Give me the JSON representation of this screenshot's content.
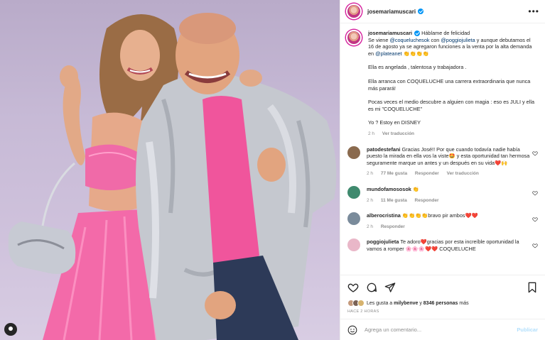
{
  "post": {
    "author": "josemariamuscari",
    "caption": {
      "title": "Háblame de felicidad",
      "p1_pre": "Se viene ",
      "p1_m1": "@coqueluchesok",
      "p1_mid": " con ",
      "p1_m2": "@poggiojulieta",
      "p1_post": " y aunque debutamos el 16 de agosto ya se agregaron funciones a la venta por la alta demanda en ",
      "p1_m3": "@plateanet",
      "p1_emoji": " 👏👏👏👏",
      "p2": "Ella es angelada , talentosa y trabajadora .",
      "p3": "Ella arranca con COQUELUCHE una carrera extraordinaria que nunca más parará!",
      "p4": "Pocas veces el medio descubre a alguien con magia : eso es JULI y ella es mi \"COQUELUCHE\"",
      "p5": "Yo ? Estoy en DISNEY",
      "time": "2 h",
      "see_translation": "Ver traducción"
    }
  },
  "comments": [
    {
      "user": "patodestefani",
      "text": "Gracias José!! Por que cuando todavía nadie había puesto la mirada en ella vos la viste🤩 y esta oportunidad tan hermosa seguramente marque un antes y un después en su vida❤️🙌",
      "time": "2 h",
      "likes": "77 Me gusta",
      "reply": "Responder",
      "translate": "Ver traducción",
      "avatar_color": "#8a6a4e"
    },
    {
      "user": "mundofamososok",
      "text": "👏",
      "time": "2 h",
      "likes": "11 Me gusta",
      "reply": "Responder",
      "avatar_color": "#3f8a6e"
    },
    {
      "user": "alberocristina",
      "text": "👏👏👏👏bravo pir ambos❤️❤️",
      "time": "2 h",
      "likes": "Responder",
      "avatar_color": "#7a8b9b"
    },
    {
      "user": "poggiojulieta",
      "text": "Te adoro❤️gracias por esta increíble oportunidad la vamos a romper 🌸🌸🌸❤️❤️ COQUELUCHE",
      "avatar_color": "#e9b7c8"
    }
  ],
  "likes_line": {
    "prefix": "Les gusta a ",
    "user": "milybenve",
    "mid": " y ",
    "count": "8346 personas",
    "suffix": " más"
  },
  "posted_ago": "HACE 2 HORAS",
  "add_comment": {
    "placeholder": "Agrega un comentario...",
    "publish": "Publicar"
  },
  "icons": [
    "heart-icon",
    "comment-icon",
    "share-icon",
    "bookmark-icon",
    "emoji-icon",
    "more-icon",
    "user-tag-icon"
  ],
  "colors": {
    "mention": "#00376b",
    "verified": "#0095f6",
    "muted": "#8e8e8e"
  }
}
